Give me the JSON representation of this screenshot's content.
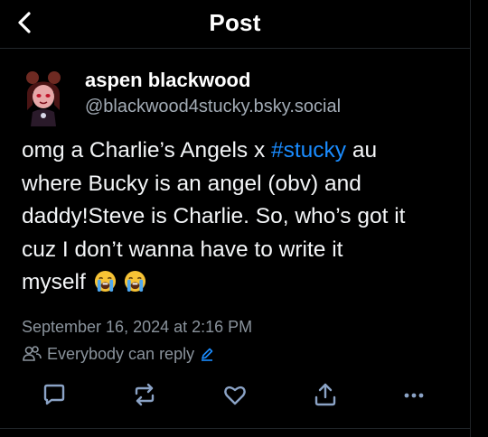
{
  "header": {
    "title": "Post",
    "back_icon": "chevron-left-icon"
  },
  "author": {
    "display_name": "aspen blackwood",
    "handle": "@blackwood4stucky.bsky.social",
    "avatar_icon": "avatar"
  },
  "post": {
    "line1_a": "omg a Charlie’s Angels x ",
    "hashtag": "#stucky",
    "line1_b": " au",
    "line2": "where Bucky is an angel (obv) and",
    "line3": "daddy!Steve is Charlie. So, who’s got it",
    "line4": "cuz I don’t wanna have to write it",
    "line5": "myself",
    "emojis": [
      "loudly-crying-face",
      "loudly-crying-face"
    ]
  },
  "meta": {
    "timestamp": "September 16, 2024 at 2:16 PM",
    "reply_setting": "Everybody can reply"
  },
  "actions": [
    {
      "name": "reply",
      "icon": "comment-icon"
    },
    {
      "name": "repost",
      "icon": "repost-icon"
    },
    {
      "name": "like",
      "icon": "heart-icon"
    },
    {
      "name": "share",
      "icon": "share-icon"
    },
    {
      "name": "more",
      "icon": "more-icon"
    }
  ],
  "colors": {
    "background": "#000000",
    "text": "#ffffff",
    "secondary_text": "#8a939c",
    "link": "#1a8cff",
    "divider": "#22272c"
  }
}
